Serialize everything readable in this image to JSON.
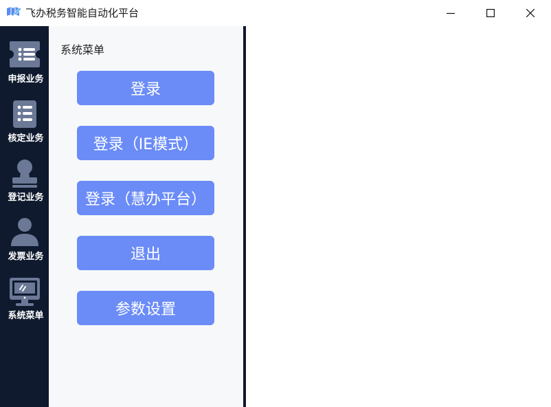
{
  "window": {
    "title": "飞办税务智能自动化平台",
    "controls": {
      "minimize_icon": "minimize-icon",
      "maximize_icon": "maximize-icon",
      "close_icon": "close-icon"
    }
  },
  "nav": {
    "items": [
      {
        "label": "申报业务",
        "icon": "declaration-list-icon"
      },
      {
        "label": "核定业务",
        "icon": "checklist-icon"
      },
      {
        "label": "登记业务",
        "icon": "registration-stamp-icon"
      },
      {
        "label": "发票业务",
        "icon": "person-icon"
      },
      {
        "label": "系统菜单",
        "icon": "monitor-icon"
      }
    ]
  },
  "menu": {
    "title": "系统菜单",
    "buttons": [
      {
        "label": "登录"
      },
      {
        "label": "登录（IE模式）"
      },
      {
        "label": "登录（慧办平台）"
      },
      {
        "label": "退出"
      },
      {
        "label": "参数设置"
      }
    ]
  },
  "colors": {
    "nav_bg": "#0f1a2e",
    "button_bg": "#6b8cf7",
    "icon_fill": "#6b7896"
  }
}
